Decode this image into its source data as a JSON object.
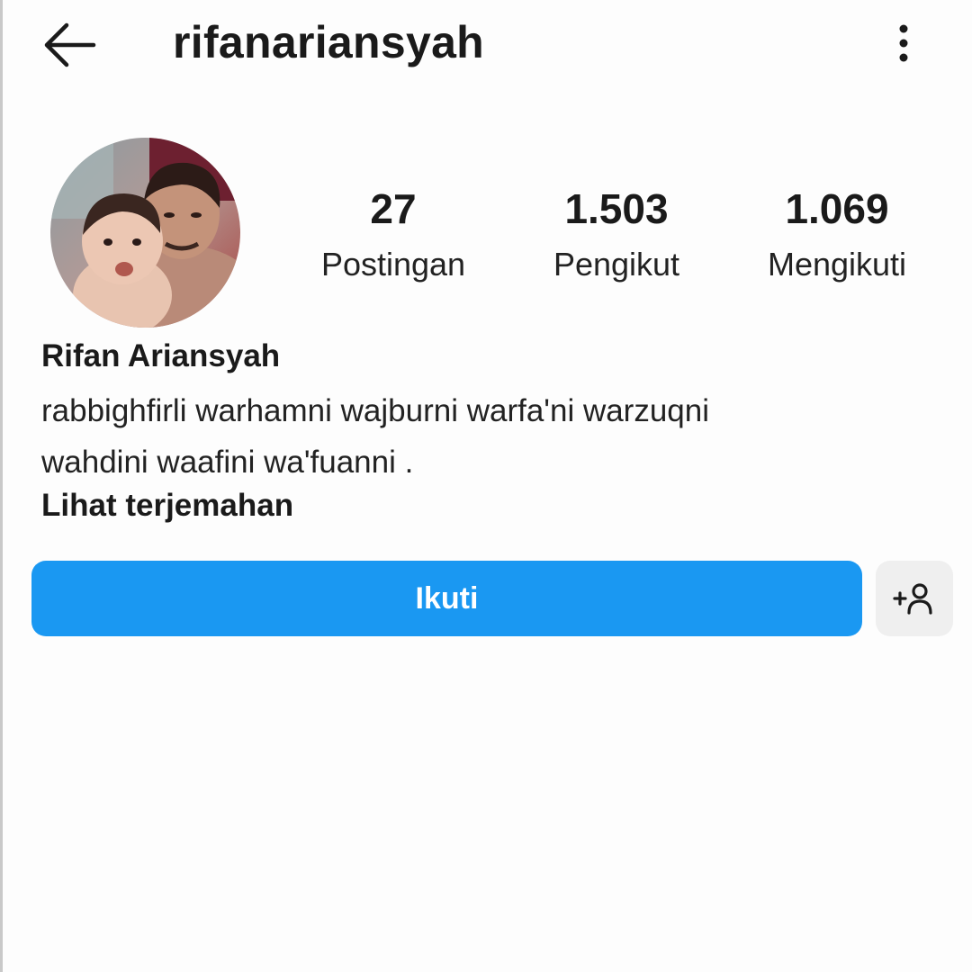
{
  "header": {
    "username": "rifanariansyah",
    "back_icon": "arrow-left-icon",
    "more_icon": "more-vertical-icon"
  },
  "profile": {
    "avatar": "profile-photo",
    "stats": [
      {
        "value": "27",
        "label": "Postingan"
      },
      {
        "value": "1.503",
        "label": "Pengikut"
      },
      {
        "value": "1.069",
        "label": "Mengikuti"
      }
    ],
    "full_name": "Rifan Ariansyah",
    "bio_lines": [
      "rabbighfirli warhamni wajburni warfa'ni warzuqni",
      "wahdini waafini wa'fuanni ."
    ],
    "translate_link": "Lihat terjemahan"
  },
  "actions": {
    "follow_label": "Ikuti",
    "suggest_icon": "add-person-icon"
  },
  "colors": {
    "accent": "#1a98f2",
    "secondary_button": "#efefef",
    "text": "#1a1a1a",
    "background": "#fdfdfd"
  }
}
